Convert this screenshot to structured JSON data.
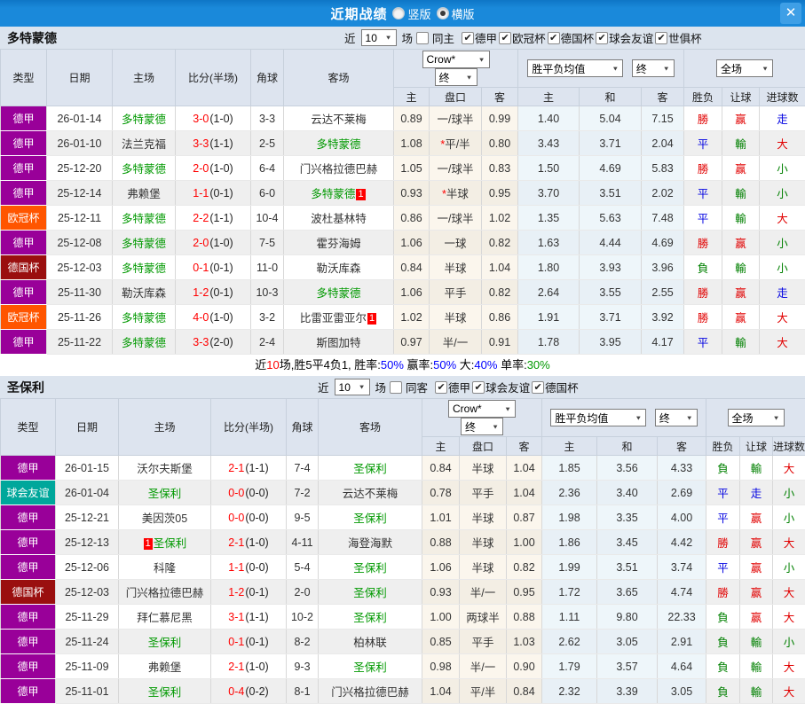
{
  "titlebar": {
    "title": "近期战绩",
    "vertical_label": "竖版",
    "vertical_checked": false,
    "horizontal_label": "横版",
    "horizontal_checked": true
  },
  "icons": {
    "close": "✕",
    "arrow": "▼",
    "check": "✔"
  },
  "league_colors": {
    "德甲": "#990099",
    "欧冠杯": "#ff5500",
    "德国杯": "#9a0f0f",
    "球会友谊": "#00a79b"
  },
  "value_colors": {
    "勝": "#e10000",
    "赢": "#e10000",
    "大": "#e10000",
    "平": "#0000e1",
    "走": "#0000e1",
    "負": "#008000",
    "輸": "#008000",
    "小": "#008000"
  },
  "columns": {
    "type": "类型",
    "date": "日期",
    "home": "主场",
    "score": "比分(半场)",
    "corner": "角球",
    "away": "客场",
    "odds_home": "主",
    "handicap": "盘口",
    "odds_away": "客",
    "avg_home": "主",
    "avg_draw": "和",
    "avg_away": "客",
    "result": "胜负",
    "handicap_result": "让球",
    "goals": "进球数"
  },
  "sections": [
    {
      "team": "多特蒙德",
      "filter": {
        "near": "近",
        "count": "10",
        "games": "场",
        "same": "同主",
        "same_checked": false,
        "leagues": [
          "德甲",
          "欧冠杯",
          "德国杯",
          "球会友谊",
          "世俱杯"
        ]
      },
      "selects": {
        "company": "Crow*",
        "final_a": "终",
        "avg": "胜平负均值",
        "final_b": "终",
        "scope": "全场"
      },
      "rows": [
        {
          "league": "德甲",
          "date": "26-01-14",
          "home": "多特蒙德",
          "home_active": true,
          "score": "3-0",
          "half": "(1-0)",
          "corner": "3-3",
          "away": "云达不莱梅",
          "away_active": false,
          "odds": [
            "0.89",
            "一/球半",
            "0.99"
          ],
          "avg": [
            "1.40",
            "5.04",
            "7.15"
          ],
          "res": "勝",
          "let": "赢",
          "goal": "走"
        },
        {
          "league": "德甲",
          "date": "26-01-10",
          "home": "法兰克福",
          "home_active": false,
          "score": "3-3",
          "half": "(1-1)",
          "corner": "2-5",
          "away": "多特蒙德",
          "away_active": true,
          "odds": [
            "1.08",
            "*平/半",
            "0.80"
          ],
          "avg": [
            "3.43",
            "3.71",
            "2.04"
          ],
          "res": "平",
          "let": "輸",
          "goal": "大"
        },
        {
          "league": "德甲",
          "date": "25-12-20",
          "home": "多特蒙德",
          "home_active": true,
          "score": "2-0",
          "half": "(1-0)",
          "corner": "6-4",
          "away": "门兴格拉德巴赫",
          "away_active": false,
          "odds": [
            "1.05",
            "一/球半",
            "0.83"
          ],
          "avg": [
            "1.50",
            "4.69",
            "5.83"
          ],
          "res": "勝",
          "let": "赢",
          "goal": "小"
        },
        {
          "league": "德甲",
          "date": "25-12-14",
          "home": "弗赖堡",
          "home_active": false,
          "score": "1-1",
          "half": "(0-1)",
          "corner": "6-0",
          "away": "多特蒙德",
          "away_active": true,
          "away_mark": "1",
          "away_mark_pos": "after",
          "odds": [
            "0.93",
            "*半球",
            "0.95"
          ],
          "avg": [
            "3.70",
            "3.51",
            "2.02"
          ],
          "res": "平",
          "let": "輸",
          "goal": "小"
        },
        {
          "league": "欧冠杯",
          "date": "25-12-11",
          "home": "多特蒙德",
          "home_active": true,
          "score": "2-2",
          "half": "(1-1)",
          "corner": "10-4",
          "away": "波杜基林特",
          "away_active": false,
          "odds": [
            "0.86",
            "一/球半",
            "1.02"
          ],
          "avg": [
            "1.35",
            "5.63",
            "7.48"
          ],
          "res": "平",
          "let": "輸",
          "goal": "大"
        },
        {
          "league": "德甲",
          "date": "25-12-08",
          "home": "多特蒙德",
          "home_active": true,
          "score": "2-0",
          "half": "(1-0)",
          "corner": "7-5",
          "away": "霍芬海姆",
          "away_active": false,
          "odds": [
            "1.06",
            "一球",
            "0.82"
          ],
          "avg": [
            "1.63",
            "4.44",
            "4.69"
          ],
          "res": "勝",
          "let": "赢",
          "goal": "小"
        },
        {
          "league": "德国杯",
          "date": "25-12-03",
          "home": "多特蒙德",
          "home_active": true,
          "score": "0-1",
          "half": "(0-1)",
          "corner": "11-0",
          "away": "勒沃库森",
          "away_active": false,
          "odds": [
            "0.84",
            "半球",
            "1.04"
          ],
          "avg": [
            "1.80",
            "3.93",
            "3.96"
          ],
          "res": "負",
          "let": "輸",
          "goal": "小"
        },
        {
          "league": "德甲",
          "date": "25-11-30",
          "home": "勒沃库森",
          "home_active": false,
          "score": "1-2",
          "half": "(0-1)",
          "corner": "10-3",
          "away": "多特蒙德",
          "away_active": true,
          "odds": [
            "1.06",
            "平手",
            "0.82"
          ],
          "avg": [
            "2.64",
            "3.55",
            "2.55"
          ],
          "res": "勝",
          "let": "赢",
          "goal": "走"
        },
        {
          "league": "欧冠杯",
          "date": "25-11-26",
          "home": "多特蒙德",
          "home_active": true,
          "score": "4-0",
          "half": "(1-0)",
          "corner": "3-2",
          "away": "比雷亚雷亚尔",
          "away_active": false,
          "away_mark": "1",
          "away_mark_pos": "after",
          "odds": [
            "1.02",
            "半球",
            "0.86"
          ],
          "avg": [
            "1.91",
            "3.71",
            "3.92"
          ],
          "res": "勝",
          "let": "赢",
          "goal": "大"
        },
        {
          "league": "德甲",
          "date": "25-11-22",
          "home": "多特蒙德",
          "home_active": true,
          "score": "3-3",
          "half": "(2-0)",
          "corner": "2-4",
          "away": "斯图加特",
          "away_active": false,
          "odds": [
            "0.97",
            "半/一",
            "0.91"
          ],
          "avg": [
            "1.78",
            "3.95",
            "4.17"
          ],
          "res": "平",
          "let": "輸",
          "goal": "大"
        }
      ],
      "summary": [
        {
          "text": "近",
          "color": "#000000"
        },
        {
          "text": "10",
          "color": "#ff0000"
        },
        {
          "text": "场,胜5平4负1, 胜率:",
          "color": "#000000"
        },
        {
          "text": "50%",
          "color": "#0000ff"
        },
        {
          "text": " 赢率:",
          "color": "#000000"
        },
        {
          "text": "50%",
          "color": "#0000ff"
        },
        {
          "text": " 大:",
          "color": "#000000"
        },
        {
          "text": "40%",
          "color": "#0000ff"
        },
        {
          "text": " 单率:",
          "color": "#000000"
        },
        {
          "text": "30%",
          "color": "#009900"
        }
      ]
    },
    {
      "team": "圣保利",
      "filter": {
        "near": "近",
        "count": "10",
        "games": "场",
        "same": "同客",
        "same_checked": false,
        "leagues": [
          "德甲",
          "球会友谊",
          "德国杯"
        ]
      },
      "selects": {
        "company": "Crow*",
        "final_a": "终",
        "avg": "胜平负均值",
        "final_b": "终",
        "scope": "全场"
      },
      "rows": [
        {
          "league": "德甲",
          "date": "26-01-15",
          "home": "沃尔夫斯堡",
          "home_active": false,
          "score": "2-1",
          "half": "(1-1)",
          "corner": "7-4",
          "away": "圣保利",
          "away_active": true,
          "odds": [
            "0.84",
            "半球",
            "1.04"
          ],
          "avg": [
            "1.85",
            "3.56",
            "4.33"
          ],
          "res": "負",
          "let": "輸",
          "goal": "大"
        },
        {
          "league": "球会友谊",
          "date": "26-01-04",
          "home": "圣保利",
          "home_active": true,
          "score": "0-0",
          "half": "(0-0)",
          "corner": "7-2",
          "away": "云达不莱梅",
          "away_active": false,
          "odds": [
            "0.78",
            "平手",
            "1.04"
          ],
          "avg": [
            "2.36",
            "3.40",
            "2.69"
          ],
          "res": "平",
          "let": "走",
          "goal": "小"
        },
        {
          "league": "德甲",
          "date": "25-12-21",
          "home": "美因茨05",
          "home_active": false,
          "score": "0-0",
          "half": "(0-0)",
          "corner": "9-5",
          "away": "圣保利",
          "away_active": true,
          "odds": [
            "1.01",
            "半球",
            "0.87"
          ],
          "avg": [
            "1.98",
            "3.35",
            "4.00"
          ],
          "res": "平",
          "let": "赢",
          "goal": "小"
        },
        {
          "league": "德甲",
          "date": "25-12-13",
          "home": "圣保利",
          "home_active": true,
          "home_mark": "1",
          "home_mark_pos": "before",
          "score": "2-1",
          "half": "(1-0)",
          "corner": "4-11",
          "away": "海登海默",
          "away_active": false,
          "odds": [
            "0.88",
            "半球",
            "1.00"
          ],
          "avg": [
            "1.86",
            "3.45",
            "4.42"
          ],
          "res": "勝",
          "let": "赢",
          "goal": "大"
        },
        {
          "league": "德甲",
          "date": "25-12-06",
          "home": "科隆",
          "home_active": false,
          "score": "1-1",
          "half": "(0-0)",
          "corner": "5-4",
          "away": "圣保利",
          "away_active": true,
          "odds": [
            "1.06",
            "半球",
            "0.82"
          ],
          "avg": [
            "1.99",
            "3.51",
            "3.74"
          ],
          "res": "平",
          "let": "赢",
          "goal": "小"
        },
        {
          "league": "德国杯",
          "date": "25-12-03",
          "home": "门兴格拉德巴赫",
          "home_active": false,
          "score": "1-2",
          "half": "(0-1)",
          "corner": "2-0",
          "away": "圣保利",
          "away_active": true,
          "odds": [
            "0.93",
            "半/一",
            "0.95"
          ],
          "avg": [
            "1.72",
            "3.65",
            "4.74"
          ],
          "res": "勝",
          "let": "赢",
          "goal": "大"
        },
        {
          "league": "德甲",
          "date": "25-11-29",
          "home": "拜仁慕尼黑",
          "home_active": false,
          "score": "3-1",
          "half": "(1-1)",
          "corner": "10-2",
          "away": "圣保利",
          "away_active": true,
          "odds": [
            "1.00",
            "两球半",
            "0.88"
          ],
          "avg": [
            "1.11",
            "9.80",
            "22.33"
          ],
          "res": "負",
          "let": "赢",
          "goal": "大"
        },
        {
          "league": "德甲",
          "date": "25-11-24",
          "home": "圣保利",
          "home_active": true,
          "score": "0-1",
          "half": "(0-1)",
          "corner": "8-2",
          "away": "柏林联",
          "away_active": false,
          "odds": [
            "0.85",
            "平手",
            "1.03"
          ],
          "avg": [
            "2.62",
            "3.05",
            "2.91"
          ],
          "res": "負",
          "let": "輸",
          "goal": "小"
        },
        {
          "league": "德甲",
          "date": "25-11-09",
          "home": "弗赖堡",
          "home_active": false,
          "score": "2-1",
          "half": "(1-0)",
          "corner": "9-3",
          "away": "圣保利",
          "away_active": true,
          "odds": [
            "0.98",
            "半/一",
            "0.90"
          ],
          "avg": [
            "1.79",
            "3.57",
            "4.64"
          ],
          "res": "負",
          "let": "輸",
          "goal": "大"
        },
        {
          "league": "德甲",
          "date": "25-11-01",
          "home": "圣保利",
          "home_active": true,
          "score": "0-4",
          "half": "(0-2)",
          "corner": "8-1",
          "away": "门兴格拉德巴赫",
          "away_active": false,
          "odds": [
            "1.04",
            "平/半",
            "0.84"
          ],
          "avg": [
            "2.32",
            "3.39",
            "3.05"
          ],
          "res": "負",
          "let": "輸",
          "goal": "大"
        }
      ]
    }
  ]
}
